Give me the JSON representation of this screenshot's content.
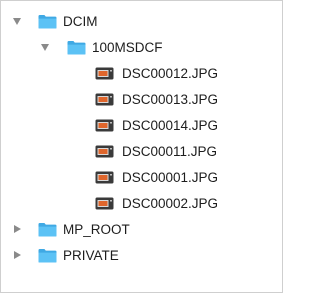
{
  "tree": {
    "dcim": {
      "label": "DCIM",
      "expanded": true,
      "icon": "folder-icon"
    },
    "msdcf": {
      "label": "100MSDCF",
      "expanded": true,
      "icon": "folder-icon"
    },
    "files": [
      {
        "label": "DSC00012.JPG",
        "icon": "jpeg-file-icon"
      },
      {
        "label": "DSC00013.JPG",
        "icon": "jpeg-file-icon"
      },
      {
        "label": "DSC00014.JPG",
        "icon": "jpeg-file-icon"
      },
      {
        "label": "DSC00011.JPG",
        "icon": "jpeg-file-icon"
      },
      {
        "label": "DSC00001.JPG",
        "icon": "jpeg-file-icon"
      },
      {
        "label": "DSC00002.JPG",
        "icon": "jpeg-file-icon"
      }
    ],
    "mp_root": {
      "label": "MP_ROOT",
      "expanded": false,
      "icon": "folder-icon"
    },
    "private": {
      "label": "PRIVATE",
      "expanded": false,
      "icon": "folder-icon"
    }
  },
  "colors": {
    "folder": "#46b6ef",
    "disclosure": "#8a8a8a",
    "file_frame": "#3a3a3a",
    "file_accent": "#e0662c"
  }
}
